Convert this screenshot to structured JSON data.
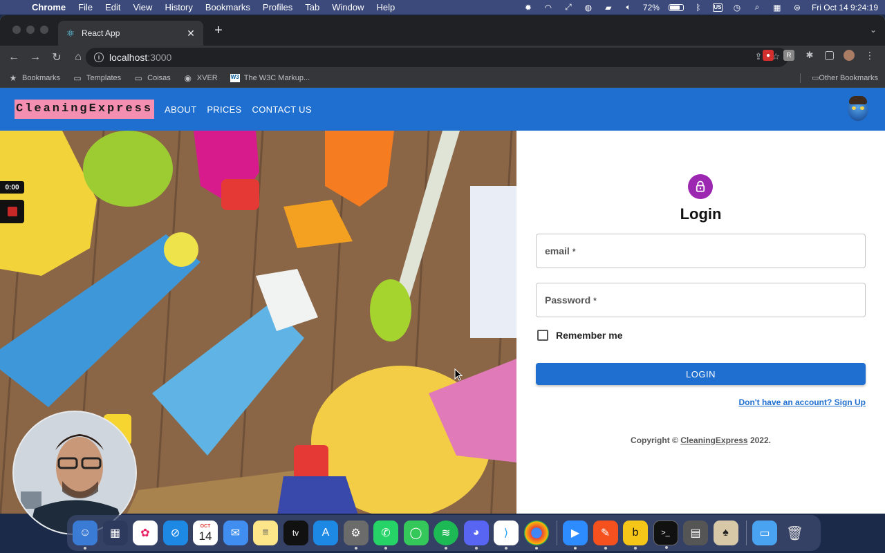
{
  "menubar": {
    "app_name": "Chrome",
    "menus": [
      "File",
      "Edit",
      "View",
      "History",
      "Bookmarks",
      "Profiles",
      "Tab",
      "Window",
      "Help"
    ],
    "battery": "72%",
    "input_source": "US",
    "datetime": "Fri Oct 14  9:24:19"
  },
  "browser": {
    "tab_title": "React App",
    "url_host": "localhost",
    "url_port": ":3000",
    "bookmarks": [
      {
        "label": "Bookmarks",
        "icon": "star-icon"
      },
      {
        "label": "Templates",
        "icon": "folder-icon"
      },
      {
        "label": "Coisas",
        "icon": "folder-icon"
      },
      {
        "label": "XVER",
        "icon": "globe-icon"
      },
      {
        "label": "The W3C Markup...",
        "icon": "w3c-icon"
      }
    ],
    "other_bookmarks": "Other Bookmarks"
  },
  "app": {
    "logo": "CleaningExpress",
    "nav": [
      "ABOUT",
      "PRICES",
      "CONTACT US"
    ],
    "colors": {
      "primary": "#1e6fcf",
      "logo_bg": "#f48fb1",
      "lock_avatar": "#9c27b0"
    }
  },
  "login": {
    "title": "Login",
    "email_label": "email",
    "password_label": "Password",
    "required_mark": "*",
    "remember_label": "Remember me",
    "button_label": "LOGIN",
    "signup_link": "Don't have an account? Sign Up",
    "copyright_prefix": "Copyright ©",
    "copyright_brand": "CleaningExpress",
    "copyright_suffix": "2022."
  },
  "recording": {
    "timer": "0:00"
  },
  "dock": {
    "calendar_month": "OCT",
    "calendar_day": "14",
    "tv_label": "tv"
  }
}
